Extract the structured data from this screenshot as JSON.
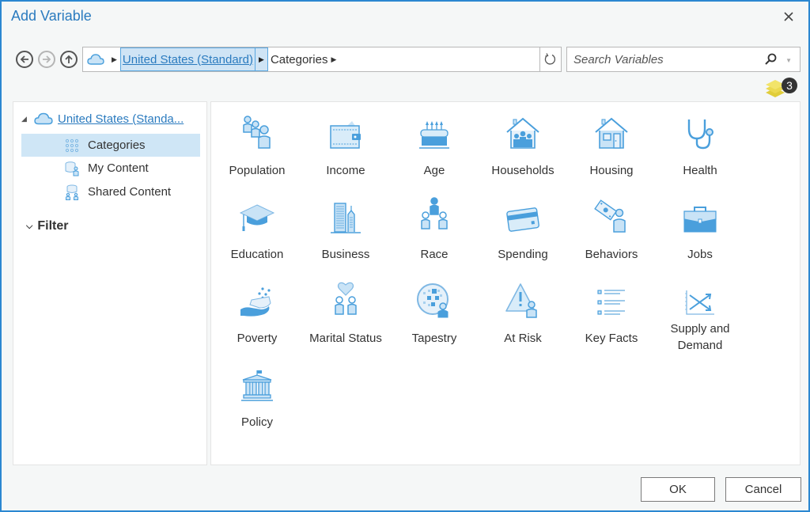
{
  "window": {
    "title": "Add Variable",
    "close_icon": "close-icon"
  },
  "navigation": {
    "back_icon": "arrow-left-icon",
    "forward_icon": "arrow-right-icon",
    "up_icon": "arrow-up-icon",
    "breadcrumb": {
      "root_icon": "cloud-icon",
      "segments": [
        {
          "label": "United States (Standard)",
          "active": true
        },
        {
          "label": "Categories",
          "active": false
        }
      ]
    },
    "refresh_icon": "refresh-icon"
  },
  "search": {
    "placeholder": "Search Variables",
    "value": "",
    "icon": "search-icon",
    "dropdown_icon": "caret-down-icon"
  },
  "selection_badge": {
    "icon": "layers-icon",
    "count": "3",
    "color": "#e8d84a"
  },
  "sidebar": {
    "root": {
      "label": "United States (Standa...",
      "expanded": true,
      "icon": "cloud-icon"
    },
    "items": [
      {
        "label": "Categories",
        "icon": "grid-dots-icon",
        "selected": true
      },
      {
        "label": "My Content",
        "icon": "database-user-icon",
        "selected": false
      },
      {
        "label": "Shared Content",
        "icon": "database-share-icon",
        "selected": false
      }
    ],
    "filter": {
      "label": "Filter",
      "expanded": true
    }
  },
  "categories": [
    {
      "label": "Population",
      "icon": "population-icon"
    },
    {
      "label": "Income",
      "icon": "wallet-icon"
    },
    {
      "label": "Age",
      "icon": "birthday-cake-icon"
    },
    {
      "label": "Households",
      "icon": "household-icon"
    },
    {
      "label": "Housing",
      "icon": "house-icon"
    },
    {
      "label": "Health",
      "icon": "stethoscope-icon"
    },
    {
      "label": "Education",
      "icon": "graduation-cap-icon"
    },
    {
      "label": "Business",
      "icon": "buildings-icon"
    },
    {
      "label": "Race",
      "icon": "people-group-icon"
    },
    {
      "label": "Spending",
      "icon": "credit-card-icon"
    },
    {
      "label": "Behaviors",
      "icon": "money-person-icon"
    },
    {
      "label": "Jobs",
      "icon": "briefcase-icon"
    },
    {
      "label": "Poverty",
      "icon": "hand-coins-icon"
    },
    {
      "label": "Marital Status",
      "icon": "couple-heart-icon"
    },
    {
      "label": "Tapestry",
      "icon": "tapestry-icon"
    },
    {
      "label": "At Risk",
      "icon": "warning-person-icon"
    },
    {
      "label": "Key Facts",
      "icon": "list-icon"
    },
    {
      "label": "Supply and Demand",
      "icon": "supply-demand-chart-icon"
    },
    {
      "label": "Policy",
      "icon": "government-building-icon"
    }
  ],
  "buttons": {
    "ok": "OK",
    "cancel": "Cancel"
  },
  "colors": {
    "accent": "#2b7bbf",
    "icon_fill": "#c9e3f6",
    "icon_stroke": "#4a9fdc",
    "selection_bg": "#cfe6f6"
  }
}
